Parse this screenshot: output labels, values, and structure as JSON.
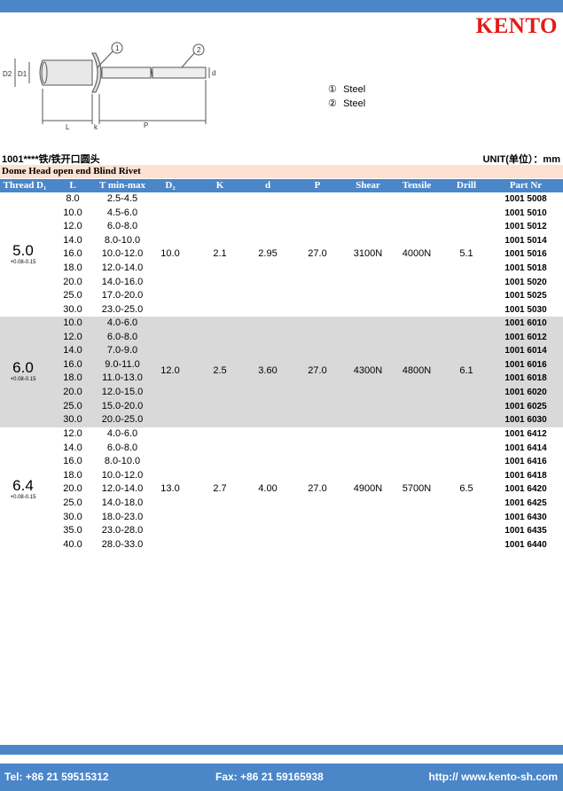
{
  "brand": {
    "logo_text": "KENTO",
    "logo_color": "#e41b17",
    "accent_color": "#4a86c8",
    "subtitle_bg": "#fde1d2",
    "shade_color": "#d9d9d9"
  },
  "diagram": {
    "labels": {
      "d2": "D2",
      "d1": "D1",
      "l": "L",
      "k": "k",
      "p": "P",
      "d": "d",
      "callout1": "1",
      "callout2": "2"
    }
  },
  "materials": [
    {
      "num": "①",
      "name": "Steel"
    },
    {
      "num": "②",
      "name": "Steel"
    }
  ],
  "title": {
    "left": "1001****铁/铁开口圆头",
    "unit": "UNIT(单位）：mm"
  },
  "subtitle": "Dome Head open end Blind Rivet",
  "headers": [
    "Thread D₁",
    "L",
    "T min-max",
    "D₂",
    "K",
    "d",
    "P",
    "Shear",
    "Tensile",
    "Drill",
    "Part Nr"
  ],
  "groups": [
    {
      "thread": "5.0",
      "tolerance": "+0.08-0.15",
      "d2": "10.0",
      "k": "2.1",
      "d": "2.95",
      "p": "27.0",
      "shear": "3100N",
      "tensile": "4000N",
      "drill": "5.1",
      "rows": [
        {
          "l": "8.0",
          "t": "2.5-4.5",
          "pn": "1001 5008"
        },
        {
          "l": "10.0",
          "t": "4.5-6.0",
          "pn": "1001 5010"
        },
        {
          "l": "12.0",
          "t": "6.0-8.0",
          "pn": "1001 5012"
        },
        {
          "l": "14.0",
          "t": "8.0-10.0",
          "pn": "1001 5014"
        },
        {
          "l": "16.0",
          "t": "10.0-12.0",
          "pn": "1001 5016"
        },
        {
          "l": "18.0",
          "t": "12.0-14.0",
          "pn": "1001 5018"
        },
        {
          "l": "20.0",
          "t": "14.0-16.0",
          "pn": "1001 5020"
        },
        {
          "l": "25.0",
          "t": "17.0-20.0",
          "pn": "1001 5025"
        },
        {
          "l": "30.0",
          "t": "23.0-25.0",
          "pn": "1001 5030"
        }
      ]
    },
    {
      "thread": "6.0",
      "tolerance": "+0.08-0.15",
      "d2": "12.0",
      "k": "2.5",
      "d": "3.60",
      "p": "27.0",
      "shear": "4300N",
      "tensile": "4800N",
      "drill": "6.1",
      "rows": [
        {
          "l": "10.0",
          "t": "4.0-6.0",
          "pn": "1001 6010"
        },
        {
          "l": "12.0",
          "t": "6.0-8.0",
          "pn": "1001 6012"
        },
        {
          "l": "14.0",
          "t": "7.0-9.0",
          "pn": "1001 6014"
        },
        {
          "l": "16.0",
          "t": "9.0-11.0",
          "pn": "1001 6016"
        },
        {
          "l": "18.0",
          "t": "11.0-13.0",
          "pn": "1001 6018"
        },
        {
          "l": "20.0",
          "t": "12.0-15.0",
          "pn": "1001 6020"
        },
        {
          "l": "25.0",
          "t": "15.0-20.0",
          "pn": "1001 6025"
        },
        {
          "l": "30.0",
          "t": "20.0-25.0",
          "pn": "1001 6030"
        }
      ]
    },
    {
      "thread": "6.4",
      "tolerance": "+0.08-0.15",
      "d2": "13.0",
      "k": "2.7",
      "d": "4.00",
      "p": "27.0",
      "shear": "4900N",
      "tensile": "5700N",
      "drill": "6.5",
      "rows": [
        {
          "l": "12.0",
          "t": "4.0-6.0",
          "pn": "1001 6412"
        },
        {
          "l": "14.0",
          "t": "6.0-8.0",
          "pn": "1001 6414"
        },
        {
          "l": "16.0",
          "t": "8.0-10.0",
          "pn": "1001 6416"
        },
        {
          "l": "18.0",
          "t": "10.0-12.0",
          "pn": "1001 6418"
        },
        {
          "l": "20.0",
          "t": "12.0-14.0",
          "pn": "1001 6420"
        },
        {
          "l": "25.0",
          "t": "14.0-18.0",
          "pn": "1001 6425"
        },
        {
          "l": "30.0",
          "t": "18.0-23.0",
          "pn": "1001 6430"
        },
        {
          "l": "35.0",
          "t": "23.0-28.0",
          "pn": "1001 6435"
        },
        {
          "l": "40.0",
          "t": "28.0-33.0",
          "pn": "1001 6440"
        }
      ]
    }
  ],
  "footer": {
    "tel": "Tel: +86 21 59515312",
    "fax": "Fax: +86 21 59165938",
    "web": "http:// www.kento-sh.com"
  }
}
